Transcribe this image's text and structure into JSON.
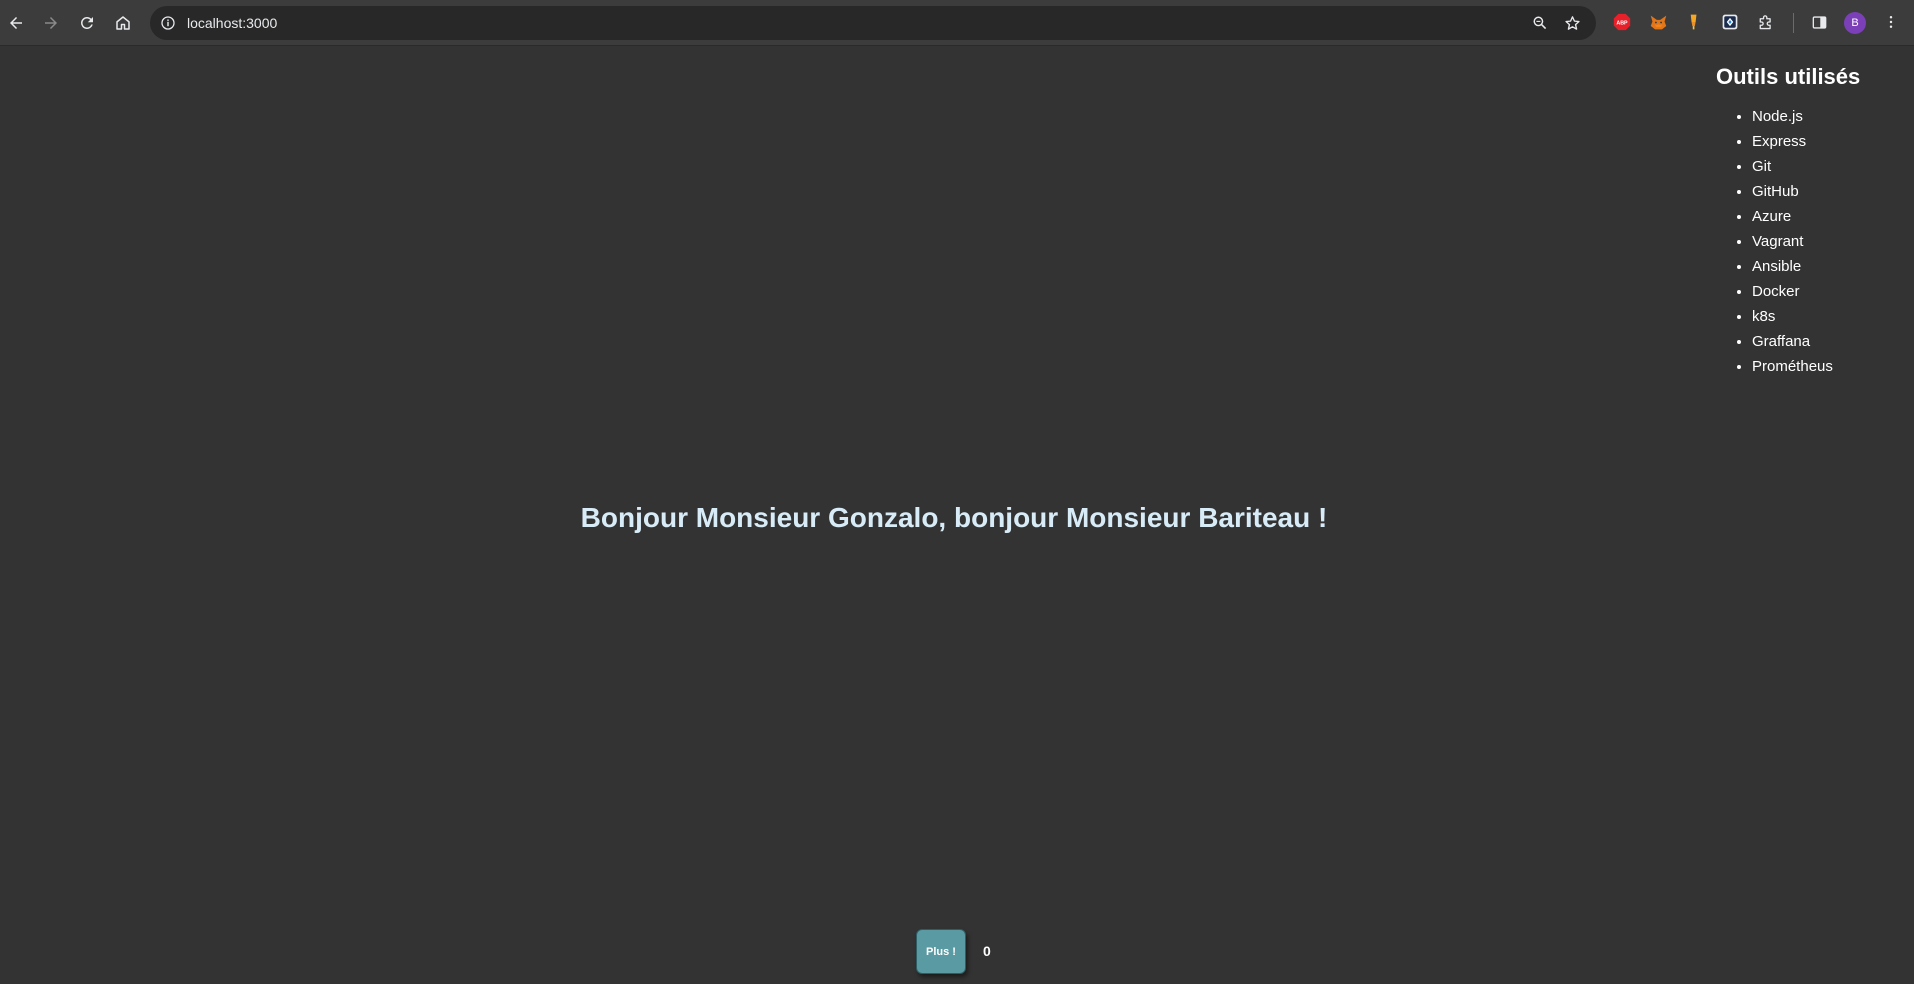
{
  "browser": {
    "url": "localhost:3000",
    "profile_initial": "B",
    "extensions": [
      {
        "name": "adblock-plus-icon",
        "label": "ABP",
        "color": "#e8202a"
      },
      {
        "name": "metamask-icon",
        "color": "#e2761b"
      },
      {
        "name": "highlighter-icon",
        "color": "#f5a623"
      },
      {
        "name": "dev-extension-icon",
        "color": "#1e88e5"
      },
      {
        "name": "extensions-puzzle-icon"
      }
    ]
  },
  "sidebar": {
    "title": "Outils utilisés",
    "tools": [
      "Node.js",
      "Express",
      "Git",
      "GitHub",
      "Azure",
      "Vagrant",
      "Ansible",
      "Docker",
      "k8s",
      "Graffana",
      "Prométheus"
    ]
  },
  "main": {
    "greeting": "Bonjour Monsieur Gonzalo, bonjour Monsieur Bariteau !"
  },
  "counter": {
    "button_label": "Plus !",
    "value": "0"
  },
  "colors": {
    "page_background": "#333333",
    "greeting_text": "#d8ecf8",
    "button_background": "#5a9aa2"
  }
}
